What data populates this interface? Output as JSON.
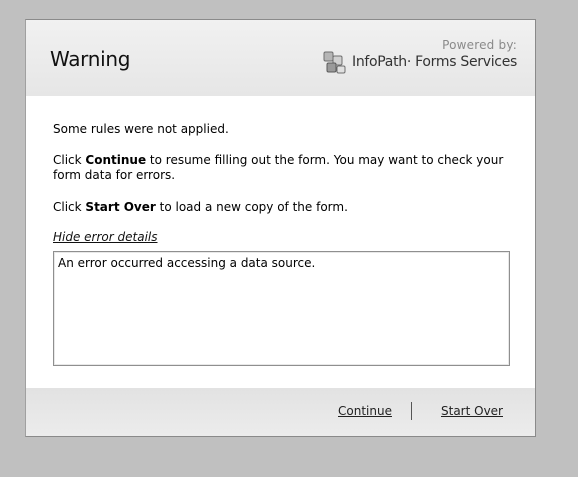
{
  "dialog": {
    "title": "Warning",
    "brand": {
      "powered_by": "Powered by:",
      "product": "InfoPath· Forms Services",
      "icon": "infopath-logo-icon"
    },
    "message": {
      "line1": "Some rules were not applied.",
      "continue_prefix": "Click ",
      "continue_bold": "Continue",
      "continue_suffix": " to resume filling out the form. You may want to check your form data for errors.",
      "startover_prefix": "Click ",
      "startover_bold": "Start Over",
      "startover_suffix": " to load a new copy of the form."
    },
    "hide_details_link": "Hide error details",
    "error_details": "An error occurred accessing a data source.",
    "buttons": {
      "continue": "Continue",
      "start_over": "Start Over"
    }
  },
  "colors": {
    "backdrop": "#c0c0c0",
    "dialog_bg": "#ffffff",
    "header_bg": "#ebebeb",
    "footer_bg": "#e6e6e6",
    "text": "#000000"
  }
}
